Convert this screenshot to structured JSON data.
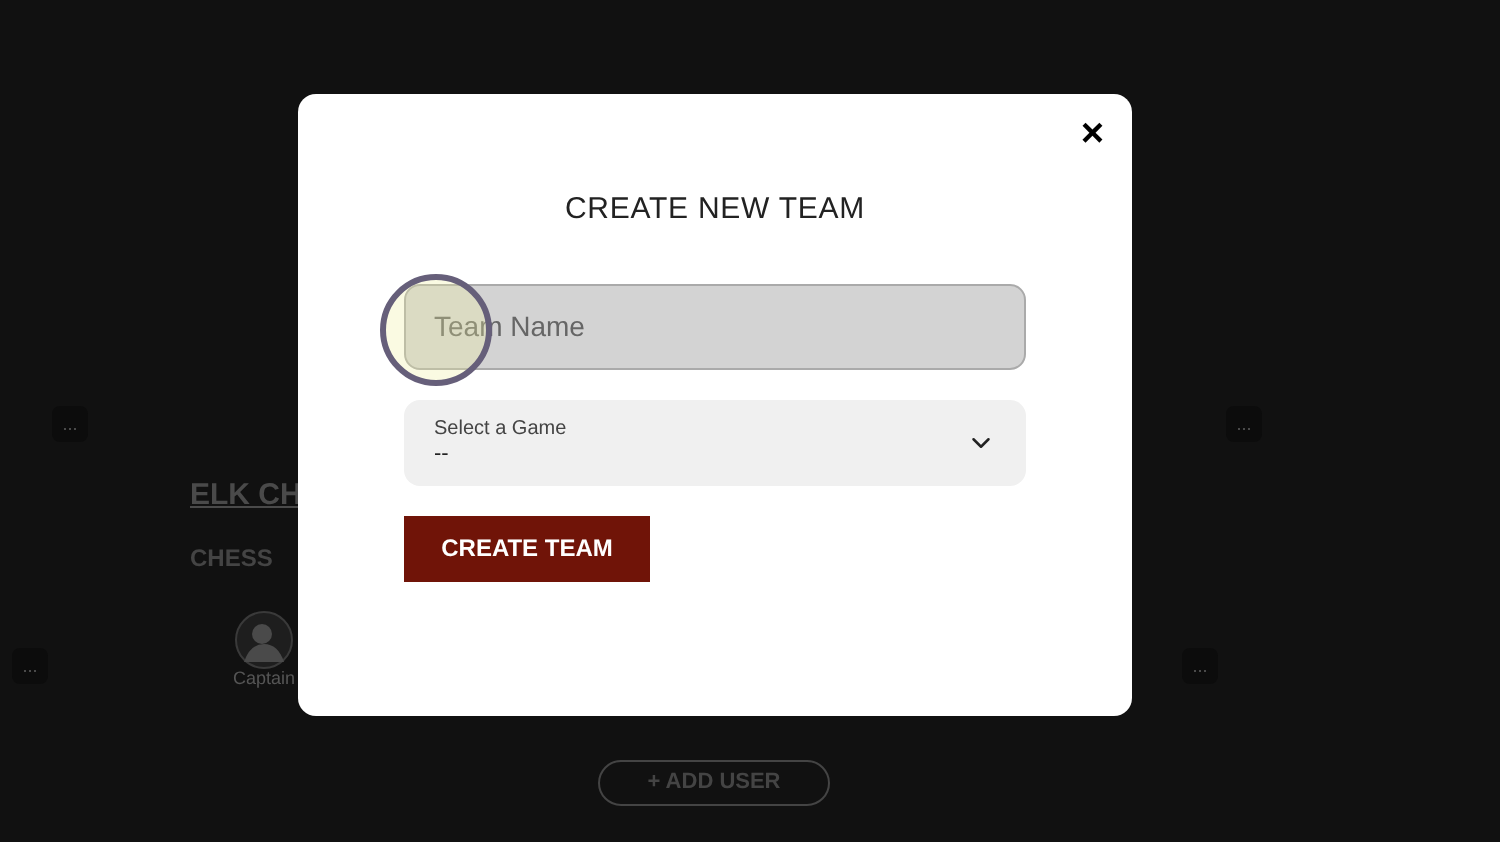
{
  "background": {
    "menu_buttons": [
      "...",
      "...",
      "...",
      "..."
    ],
    "team_name": "ELK CH",
    "game": "CHESS",
    "member_role": "Captain",
    "add_user_button": "+ ADD USER"
  },
  "dialog": {
    "title": "CREATE NEW TEAM",
    "close": "×",
    "team_name_field": {
      "placeholder": "Team Name",
      "focused": true
    },
    "game_select": {
      "label": "Select a Game",
      "value": "--"
    },
    "submit_button": "CREATE TEAM"
  }
}
